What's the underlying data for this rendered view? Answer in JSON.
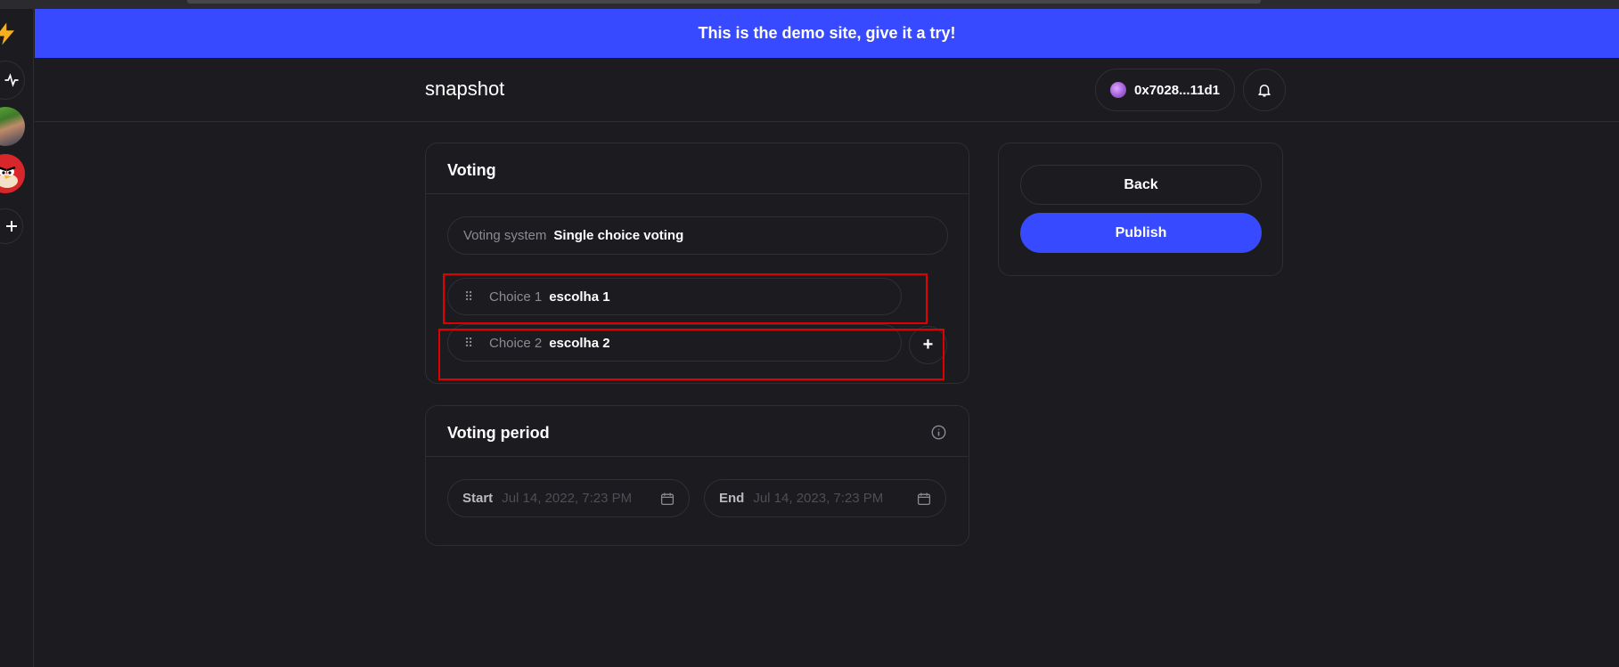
{
  "banner": {
    "text": "This is the demo site, give it a try!"
  },
  "header": {
    "title": "snapshot",
    "account": "0x7028...11d1"
  },
  "sidebar": {
    "icons": [
      "bolt-icon",
      "activity-icon",
      "space-avatar",
      "angry-bird-avatar",
      "plus-icon"
    ]
  },
  "voting": {
    "title": "Voting",
    "system_label": "Voting system",
    "system_value": "Single choice voting",
    "choices": [
      {
        "label": "Choice 1",
        "value": "escolha 1"
      },
      {
        "label": "Choice 2",
        "value": "escolha 2"
      }
    ],
    "add_label": "+"
  },
  "period": {
    "title": "Voting period",
    "start_label": "Start",
    "start_placeholder": "Jul 14, 2022, 7:23 PM",
    "end_label": "End",
    "end_placeholder": "Jul 14, 2023, 7:23 PM"
  },
  "actions": {
    "back": "Back",
    "publish": "Publish"
  },
  "colors": {
    "accent": "#384aff",
    "background": "#1c1b20",
    "border": "#2d2d33",
    "highlight": "#e00000"
  }
}
